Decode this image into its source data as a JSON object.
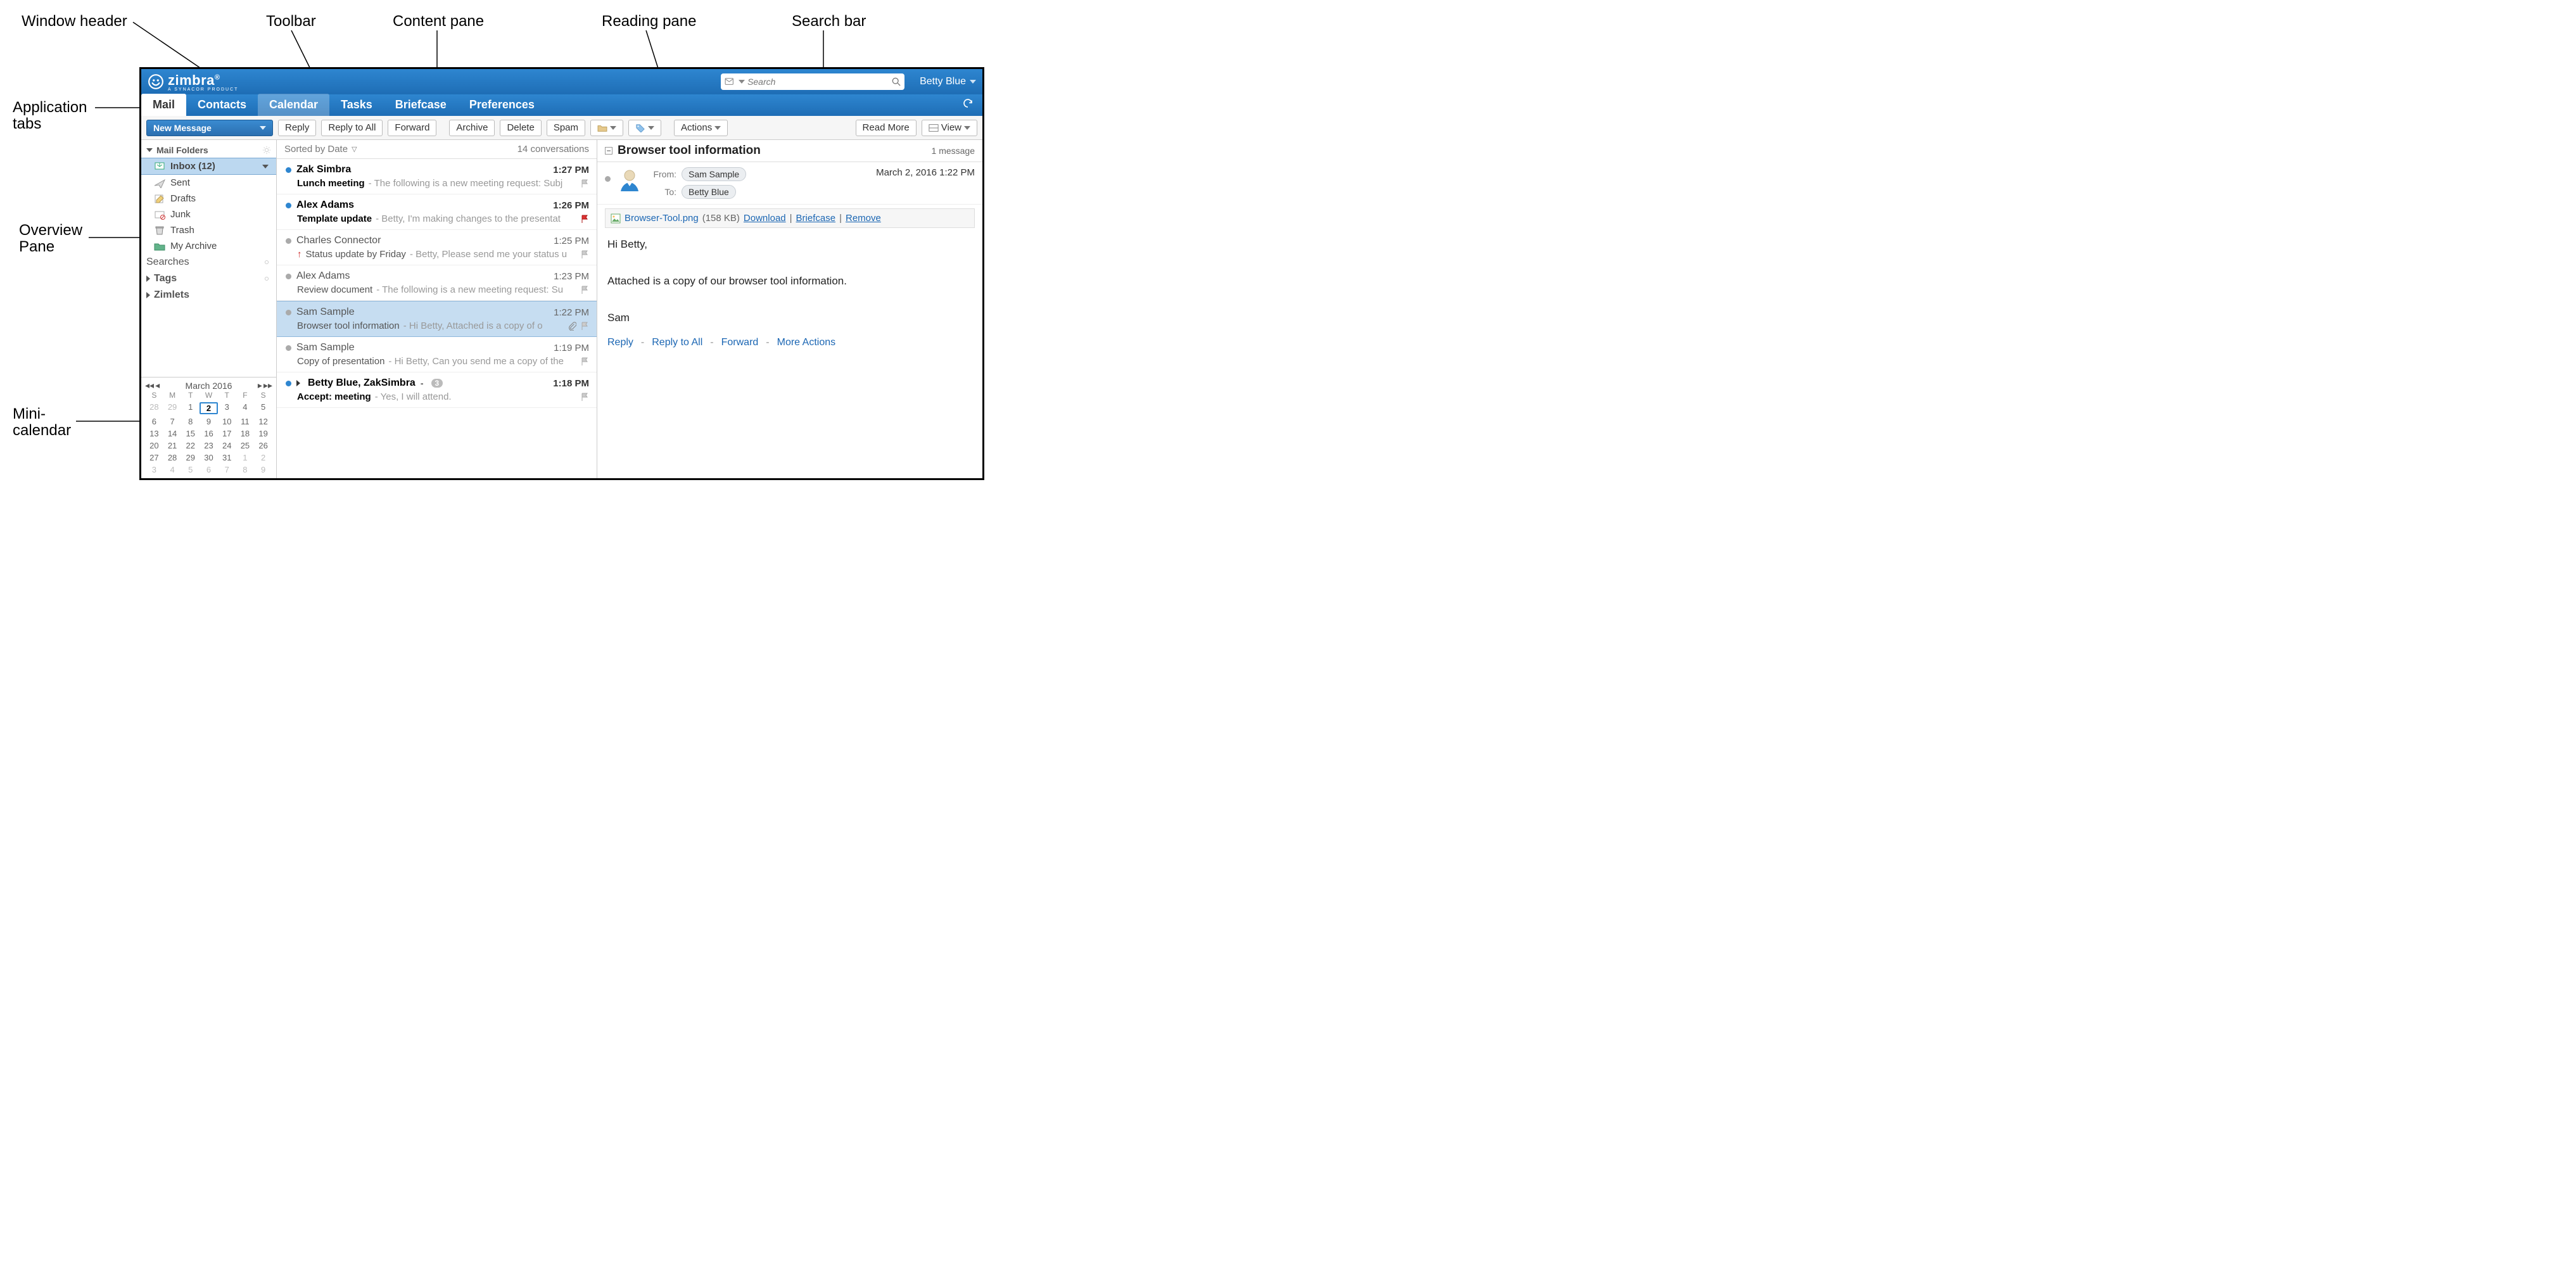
{
  "annotations": {
    "window_header": "Window header",
    "toolbar": "Toolbar",
    "content_pane": "Content pane",
    "reading_pane": "Reading pane",
    "search_bar": "Search bar",
    "app_tabs_l1": "Application",
    "app_tabs_l2": "tabs",
    "overview_l1": "Overview",
    "overview_l2": "Pane",
    "minical_l1": "Mini-",
    "minical_l2": "calendar"
  },
  "header": {
    "brand": "zimbra",
    "brand_sub": "A SYNACOR PRODUCT",
    "search_placeholder": "Search",
    "user": "Betty Blue"
  },
  "tabs": [
    "Mail",
    "Contacts",
    "Calendar",
    "Tasks",
    "Briefcase",
    "Preferences"
  ],
  "toolbar": {
    "new_message": "New Message",
    "reply": "Reply",
    "reply_all": "Reply to All",
    "forward": "Forward",
    "archive": "Archive",
    "delete": "Delete",
    "spam": "Spam",
    "actions": "Actions",
    "read_more": "Read More",
    "view": "View"
  },
  "overview": {
    "mail_folders": "Mail Folders",
    "inbox_label": "Inbox (12)",
    "sent": "Sent",
    "drafts": "Drafts",
    "junk": "Junk",
    "trash": "Trash",
    "my_archive": "My Archive",
    "searches": "Searches",
    "tags": "Tags",
    "zimlets": "Zimlets"
  },
  "minical": {
    "title": "March 2016",
    "dow": [
      "S",
      "M",
      "T",
      "W",
      "T",
      "F",
      "S"
    ],
    "rows": [
      [
        {
          "d": "28",
          "o": true
        },
        {
          "d": "29",
          "o": true
        },
        {
          "d": "1"
        },
        {
          "d": "2",
          "today": true
        },
        {
          "d": "3"
        },
        {
          "d": "4"
        },
        {
          "d": "5"
        }
      ],
      [
        {
          "d": "6"
        },
        {
          "d": "7"
        },
        {
          "d": "8"
        },
        {
          "d": "9"
        },
        {
          "d": "10"
        },
        {
          "d": "11"
        },
        {
          "d": "12"
        }
      ],
      [
        {
          "d": "13"
        },
        {
          "d": "14"
        },
        {
          "d": "15"
        },
        {
          "d": "16"
        },
        {
          "d": "17"
        },
        {
          "d": "18"
        },
        {
          "d": "19"
        }
      ],
      [
        {
          "d": "20"
        },
        {
          "d": "21"
        },
        {
          "d": "22"
        },
        {
          "d": "23"
        },
        {
          "d": "24"
        },
        {
          "d": "25"
        },
        {
          "d": "26"
        }
      ],
      [
        {
          "d": "27"
        },
        {
          "d": "28"
        },
        {
          "d": "29"
        },
        {
          "d": "30"
        },
        {
          "d": "31"
        },
        {
          "d": "1",
          "o": true
        },
        {
          "d": "2",
          "o": true
        }
      ],
      [
        {
          "d": "3",
          "o": true
        },
        {
          "d": "4",
          "o": true
        },
        {
          "d": "5",
          "o": true
        },
        {
          "d": "6",
          "o": true
        },
        {
          "d": "7",
          "o": true
        },
        {
          "d": "8",
          "o": true
        },
        {
          "d": "9",
          "o": true
        }
      ]
    ]
  },
  "content": {
    "sort_label": "Sorted by Date",
    "count_label": "14 conversations",
    "items": [
      {
        "unread": true,
        "sender": "Zak Simbra",
        "time": "1:27 PM",
        "subject": "Lunch meeting",
        "fragment": "- The following is a new meeting request: Subj",
        "flag": "grey"
      },
      {
        "unread": true,
        "sender": "Alex Adams",
        "time": "1:26 PM",
        "subject": "Template update",
        "fragment": "- Betty, I'm making changes to the presentat",
        "flag": "red"
      },
      {
        "unread": false,
        "sender": "Charles Connector",
        "time": "1:25 PM",
        "subject": "Status update by Friday",
        "fragment": "- Betty, Please send me your status u",
        "flag": "grey",
        "priority": "high"
      },
      {
        "unread": false,
        "sender": "Alex Adams",
        "time": "1:23 PM",
        "subject": "Review document",
        "fragment": "- The following is a new meeting request: Su",
        "flag": "grey"
      },
      {
        "unread": false,
        "sender": "Sam Sample",
        "time": "1:22 PM",
        "subject": "Browser tool information",
        "fragment": "- Hi Betty, Attached is a copy of o",
        "flag": "grey",
        "attachment": true,
        "selected": true
      },
      {
        "unread": false,
        "sender": "Sam Sample",
        "time": "1:19 PM",
        "subject": "Copy of presentation",
        "fragment": "- Hi Betty, Can you send me a copy of the",
        "flag": "grey"
      },
      {
        "unread": true,
        "sender": "Betty Blue, ZakSimbra",
        "time": "1:18 PM",
        "subject": "Accept: meeting",
        "fragment": "- Yes, I will attend.",
        "flag": "grey",
        "expandable": true,
        "count": "3",
        "trailing_dash": " -"
      }
    ]
  },
  "reading": {
    "title": "Browser tool information",
    "count": "1 message",
    "from_label": "From:",
    "from_value": "Sam Sample",
    "to_label": "To:",
    "to_value": "Betty Blue",
    "date": "March 2, 2016 1:22 PM",
    "attachment_name": "Browser-Tool.png",
    "attachment_size": "(158 KB)",
    "download": "Download",
    "briefcase": "Briefcase",
    "remove": "Remove",
    "body_l1": "Hi Betty,",
    "body_l2": "Attached is a copy of our browser tool information.",
    "body_l3": "Sam",
    "act_reply": "Reply",
    "act_reply_all": "Reply to All",
    "act_forward": "Forward",
    "act_more": "More Actions"
  }
}
